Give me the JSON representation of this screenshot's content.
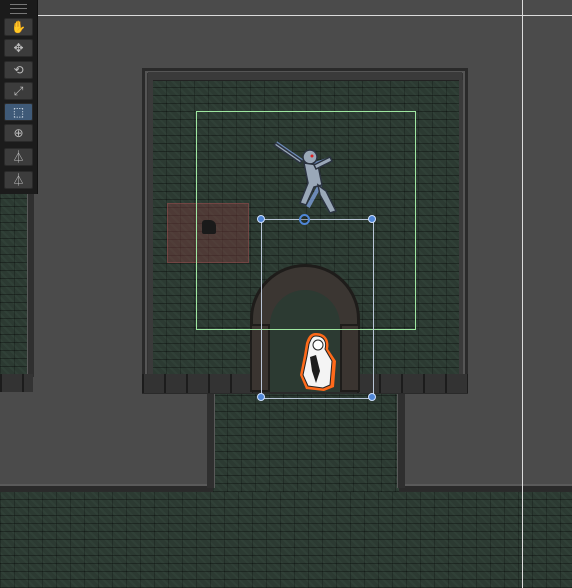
{
  "toolbar": {
    "tools": [
      {
        "name": "hand-tool",
        "glyph": "✋"
      },
      {
        "name": "move-tool",
        "glyph": "✥"
      },
      {
        "name": "rotate-tool",
        "glyph": "⟲"
      },
      {
        "name": "scale-tool",
        "glyph": "⤢"
      },
      {
        "name": "rect-tool",
        "glyph": "⬚"
      },
      {
        "name": "transform-tool",
        "glyph": "⊕"
      },
      {
        "name": "custom-tool-a",
        "glyph": "⏃"
      },
      {
        "name": "custom-tool-b",
        "glyph": "⏃"
      }
    ],
    "active_tool": "rect-tool"
  },
  "scene": {
    "selection_color": "#4f86d6",
    "bounds_color": "#9ee6a0",
    "player_outline_color": "#ff6a1a",
    "enemy_glow_color": "#8fb4ff"
  }
}
